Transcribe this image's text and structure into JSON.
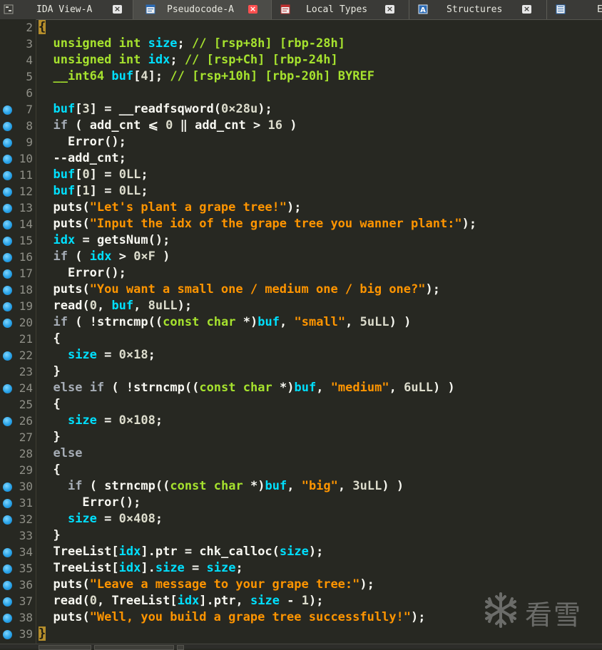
{
  "tabs": [
    {
      "label": "IDA View-A",
      "icon": "graph-view-icon",
      "active": false
    },
    {
      "label": "Pseudocode-A",
      "icon": "pseudocode-icon",
      "active": true
    },
    {
      "label": "Local Types",
      "icon": "local-types-icon",
      "active": false
    },
    {
      "label": "Structures",
      "icon": "structures-icon",
      "active": false
    },
    {
      "label": "E",
      "icon": "enums-icon",
      "active": false
    }
  ],
  "tab_close_glyph": "×",
  "watermark": {
    "text": "看雪",
    "icon": "snowflake-icon"
  },
  "colors": {
    "background": "#272822",
    "breakpoint": "#29a3e8",
    "string": "#ff9500",
    "variable": "#00e0ff",
    "type": "#a6e22e",
    "active_tab_close": "#ff5050"
  },
  "lines": [
    {
      "n": "2",
      "bp": false,
      "text": "{"
    },
    {
      "n": "3",
      "bp": false,
      "text": "  unsigned int size; // [rsp+8h] [rbp-28h]"
    },
    {
      "n": "4",
      "bp": false,
      "text": "  unsigned int idx; // [rsp+Ch] [rbp-24h]"
    },
    {
      "n": "5",
      "bp": false,
      "text": "  __int64 buf[4]; // [rsp+10h] [rbp-20h] BYREF"
    },
    {
      "n": "6",
      "bp": false,
      "text": ""
    },
    {
      "n": "7",
      "bp": true,
      "text": "  buf[3] = __readfsqword(0x28u);"
    },
    {
      "n": "8",
      "bp": true,
      "text": "  if ( add_cnt <= 0 || add_cnt > 16 )"
    },
    {
      "n": "9",
      "bp": true,
      "text": "    Error();"
    },
    {
      "n": "10",
      "bp": true,
      "text": "  --add_cnt;"
    },
    {
      "n": "11",
      "bp": true,
      "text": "  buf[0] = 0LL;"
    },
    {
      "n": "12",
      "bp": true,
      "text": "  buf[1] = 0LL;"
    },
    {
      "n": "13",
      "bp": true,
      "text": "  puts(\"Let's plant a grape tree!\");"
    },
    {
      "n": "14",
      "bp": true,
      "text": "  puts(\"Input the idx of the grape tree you wanner plant:\");"
    },
    {
      "n": "15",
      "bp": true,
      "text": "  idx = getsNum();"
    },
    {
      "n": "16",
      "bp": true,
      "text": "  if ( idx > 0xF )"
    },
    {
      "n": "17",
      "bp": true,
      "text": "    Error();"
    },
    {
      "n": "18",
      "bp": true,
      "text": "  puts(\"You want a small one / medium one / big one?\");"
    },
    {
      "n": "19",
      "bp": true,
      "text": "  read(0, buf, 8uLL);"
    },
    {
      "n": "20",
      "bp": true,
      "text": "  if ( !strncmp((const char *)buf, \"small\", 5uLL) )"
    },
    {
      "n": "21",
      "bp": false,
      "text": "  {"
    },
    {
      "n": "22",
      "bp": true,
      "text": "    size = 0x18;"
    },
    {
      "n": "23",
      "bp": false,
      "text": "  }"
    },
    {
      "n": "24",
      "bp": true,
      "text": "  else if ( !strncmp((const char *)buf, \"medium\", 6uLL) )"
    },
    {
      "n": "25",
      "bp": false,
      "text": "  {"
    },
    {
      "n": "26",
      "bp": true,
      "text": "    size = 0x108;"
    },
    {
      "n": "27",
      "bp": false,
      "text": "  }"
    },
    {
      "n": "28",
      "bp": false,
      "text": "  else"
    },
    {
      "n": "29",
      "bp": false,
      "text": "  {"
    },
    {
      "n": "30",
      "bp": true,
      "text": "    if ( strncmp((const char *)buf, \"big\", 3uLL) )"
    },
    {
      "n": "31",
      "bp": true,
      "text": "      Error();"
    },
    {
      "n": "32",
      "bp": true,
      "text": "    size = 0x408;"
    },
    {
      "n": "33",
      "bp": false,
      "text": "  }"
    },
    {
      "n": "34",
      "bp": true,
      "text": "  TreeList[idx].ptr = chk_calloc(size);"
    },
    {
      "n": "35",
      "bp": true,
      "text": "  TreeList[idx].size = size;"
    },
    {
      "n": "36",
      "bp": true,
      "text": "  puts(\"Leave a message to your grape tree:\");"
    },
    {
      "n": "37",
      "bp": true,
      "text": "  read(0, TreeList[idx].ptr, size - 1);"
    },
    {
      "n": "38",
      "bp": true,
      "text": "  puts(\"Well, you build a grape tree successfully!\");"
    },
    {
      "n": "39",
      "bp": true,
      "text": "}"
    }
  ]
}
